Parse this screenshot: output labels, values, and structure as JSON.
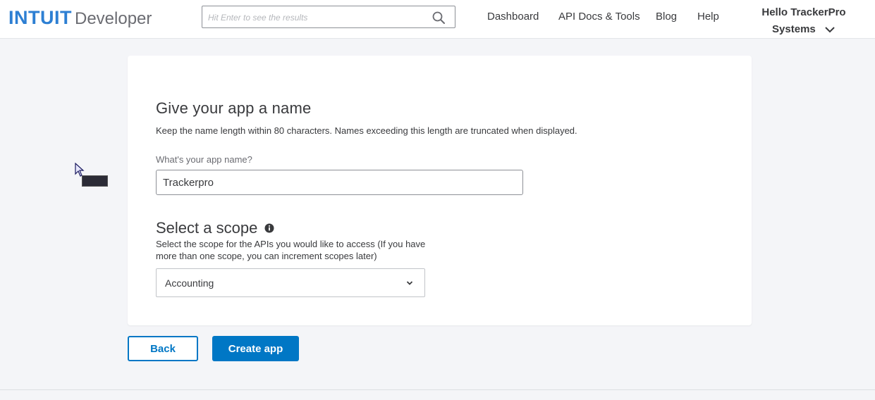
{
  "header": {
    "logo_brand": "INTUIT",
    "logo_product": "Developer",
    "search_placeholder": "Hit Enter to see the results",
    "nav": [
      "Dashboard",
      "API Docs & Tools",
      "Blog",
      "Help"
    ],
    "user_greeting_line1": "Hello TrackerPro",
    "user_greeting_line2": "Systems"
  },
  "form": {
    "title": "Give your app a name",
    "description": "Keep the name length within 80 characters. Names exceeding this length are truncated when displayed.",
    "name_label": "What's your app name?",
    "name_value": "Trackerpro",
    "scope_title": "Select a scope",
    "scope_description": "Select the scope for the APIs you would like to access (If you have more than one scope, you can increment scopes later)",
    "scope_selected": "Accounting"
  },
  "actions": {
    "back_label": "Back",
    "create_label": "Create app"
  },
  "colors": {
    "brand_blue": "#0077c5",
    "text": "#393a3d",
    "background": "#f4f5f8"
  }
}
